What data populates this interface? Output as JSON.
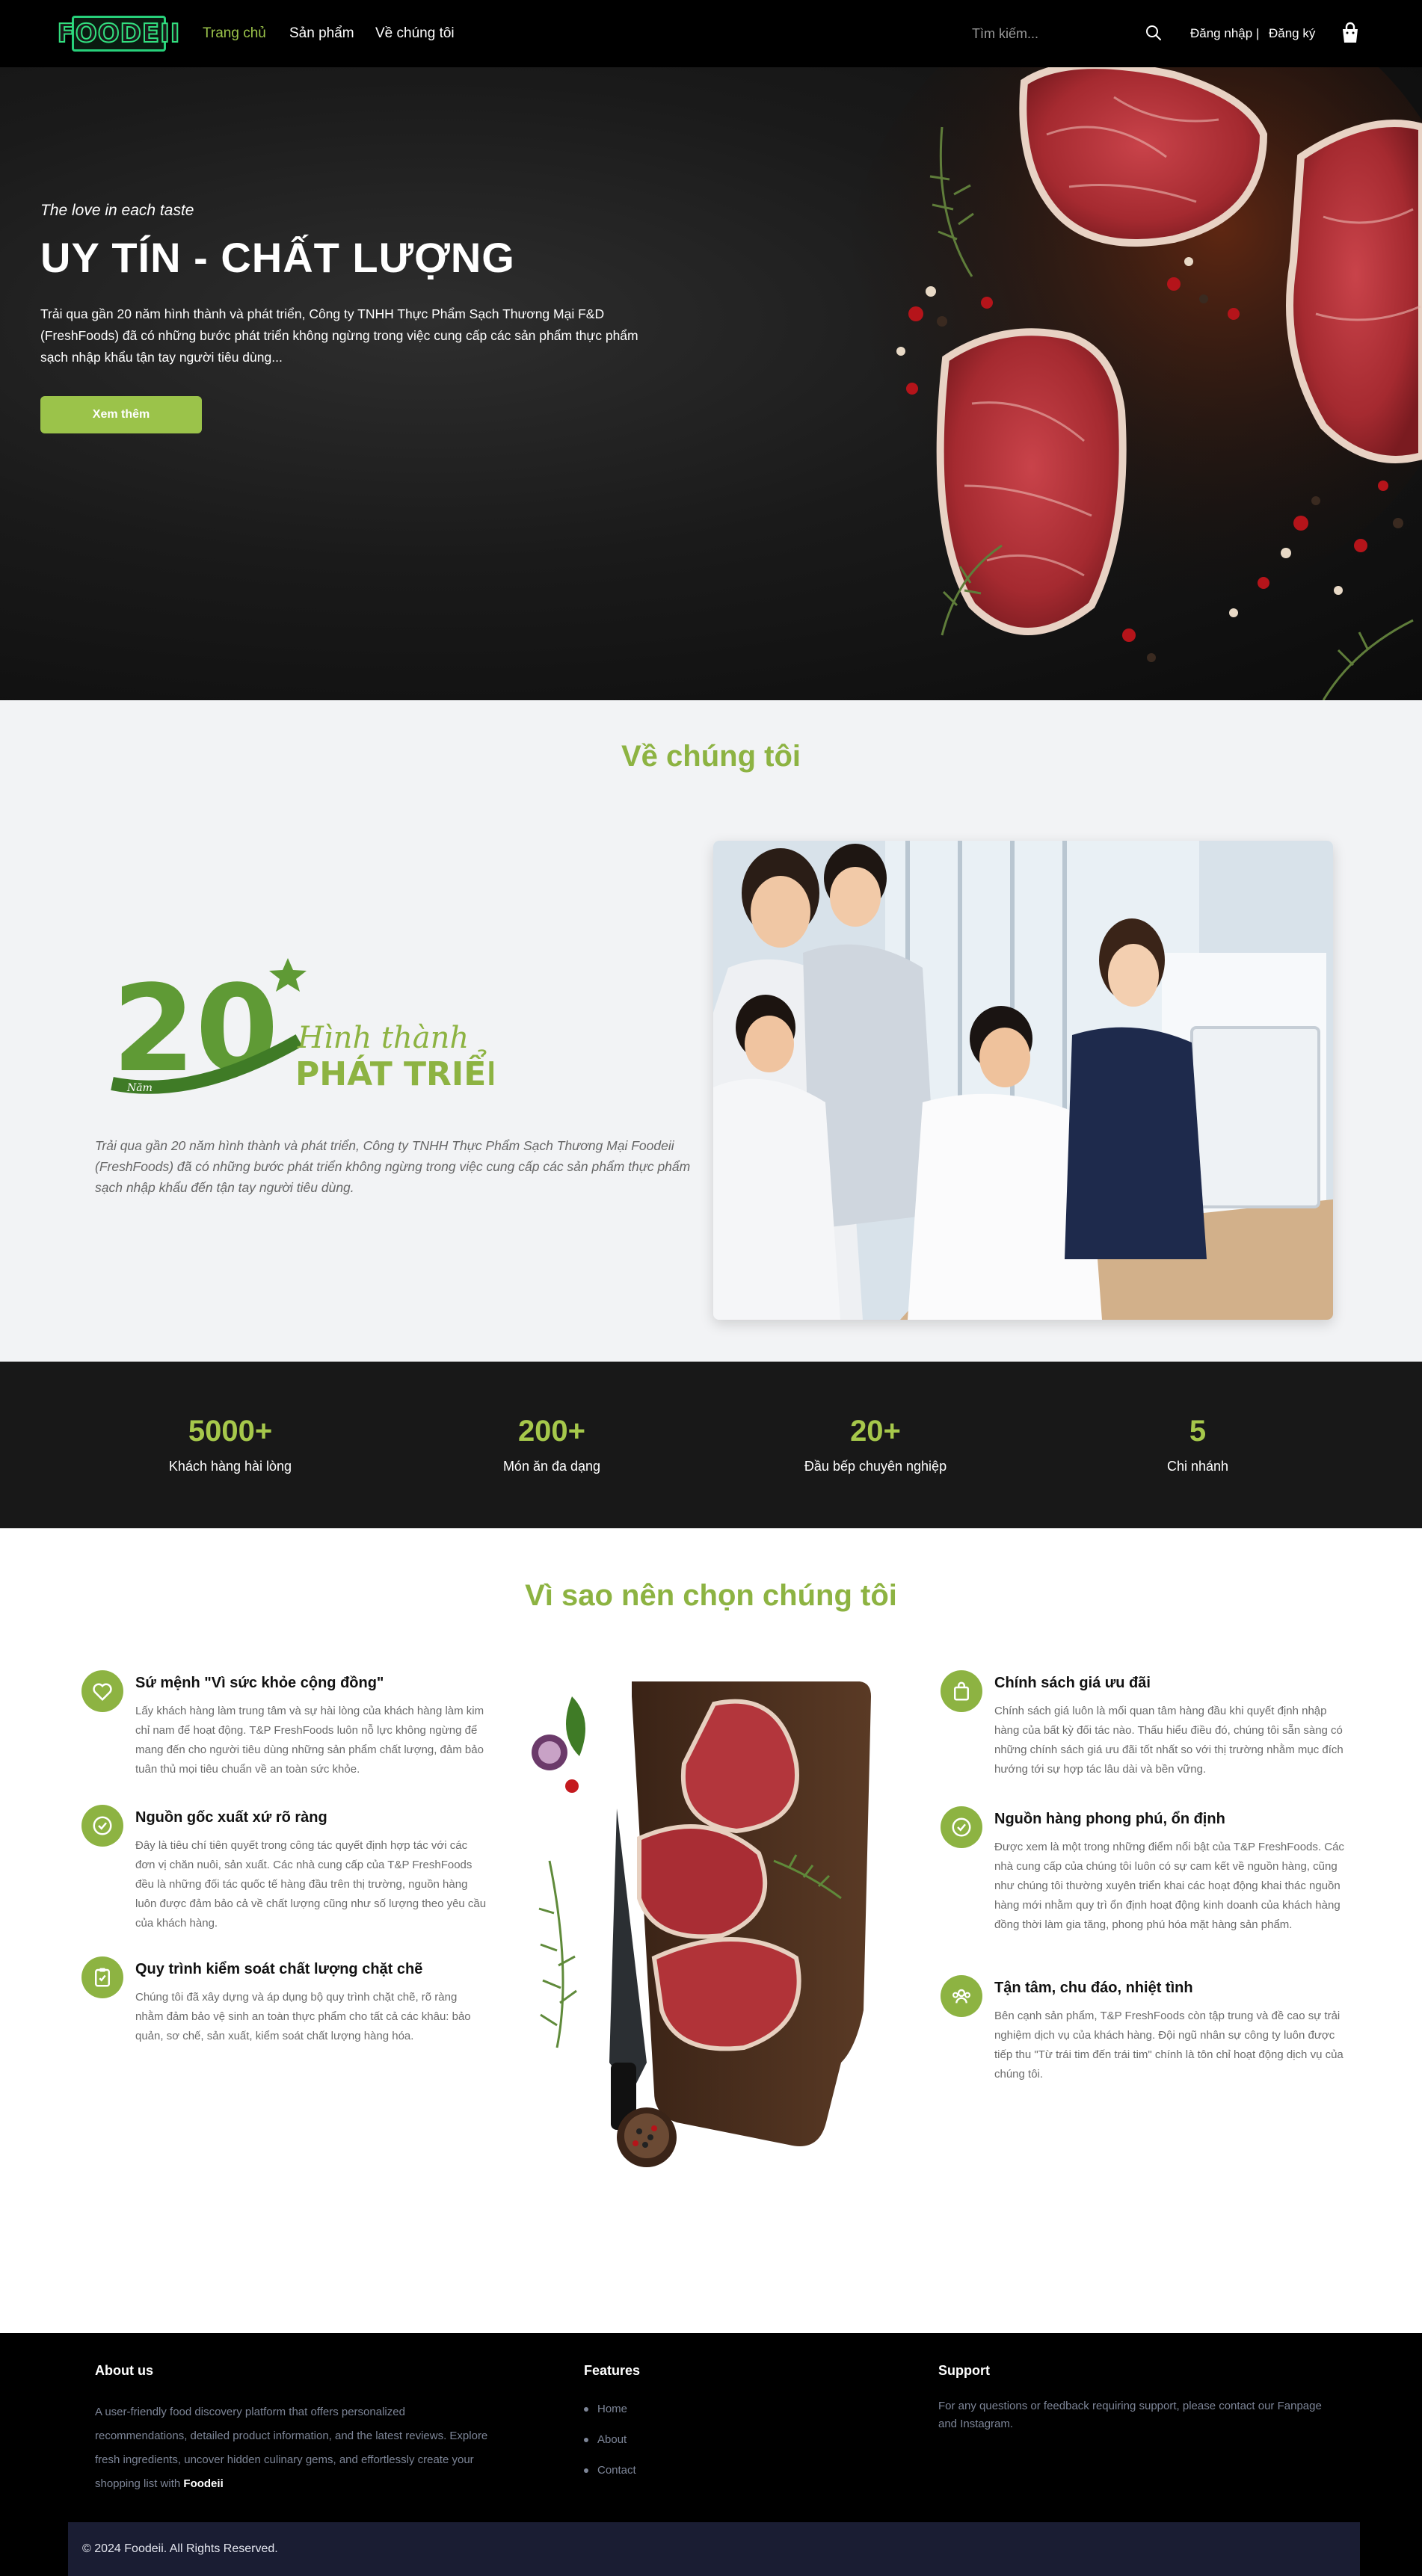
{
  "nav": {
    "logo": "FOODEII",
    "links": [
      "Trang chủ",
      "Sản phẩm",
      "Về chúng tôi"
    ],
    "active_index": 0,
    "search_placeholder": "Tìm kiếm...",
    "login": "Đăng nhập",
    "separator": "|",
    "register": "Đăng ký",
    "icons": [
      "search-icon",
      "shopping-bag-icon"
    ]
  },
  "hero": {
    "tagline": "The love in each taste",
    "title": "UY TÍN - CHẤT LƯỢNG",
    "description": "Trải qua gần 20 năm hình thành và phát triển, Công ty TNHH Thực Phẩm Sạch Thương Mại F&D (FreshFoods) đã có những bước phát triển không ngừng trong việc cung cấp các sản phẩm thực phẩm sạch nhập khẩu tận tay người tiêu dùng...",
    "button": "Xem thêm"
  },
  "about": {
    "title": "Về chúng tôi",
    "badge": {
      "number": "20",
      "word_small": "Năm",
      "line1": "Hình thành",
      "line2": "PHÁT TRIỂN"
    },
    "description": "Trải qua gần 20 năm hình thành và phát triển, Công ty TNHH Thực Phẩm Sạch Thương Mại Foodeii (FreshFoods) đã có những bước phát triển không ngừng trong việc cung cấp các sản phẩm thực phẩm sạch nhập khẩu đến tận tay người tiêu dùng."
  },
  "stats": [
    {
      "value": "5000+",
      "label": "Khách hàng hài lòng"
    },
    {
      "value": "200+",
      "label": "Món ăn đa dạng"
    },
    {
      "value": "20+",
      "label": "Đầu bếp chuyên nghiệp"
    },
    {
      "value": "5",
      "label": "Chi nhánh"
    }
  ],
  "why": {
    "title": "Vì sao nên chọn chúng tôi",
    "left": [
      {
        "icon": "heart-icon",
        "title": "Sứ mệnh \"Vì sức khỏe cộng đồng\"",
        "desc": "Lấy khách hàng làm trung tâm và sự hài lòng của khách hàng làm kim chỉ nam để hoạt động. T&P FreshFoods luôn nỗ lực không ngừng để mang đến cho người tiêu dùng những sản phẩm chất lượng, đảm bảo tuân thủ mọi tiêu chuẩn về an toàn sức khỏe."
      },
      {
        "icon": "check-circle-icon",
        "title": "Nguồn gốc xuất xứ rõ ràng",
        "desc": "Đây là tiêu chí tiên quyết trong công tác quyết định hợp tác với các đơn vị chăn nuôi, sản xuất. Các nhà cung cấp của T&P FreshFoods đều là những đối tác quốc tế hàng đầu trên thị trường, nguồn hàng luôn được đảm bảo cả về chất lượng cũng như số lượng theo yêu cầu của khách hàng."
      },
      {
        "icon": "clipboard-check-icon",
        "title": "Quy trình kiểm soát chất lượng chặt chẽ",
        "desc": "Chúng tôi đã xây dựng và áp dụng bộ quy trình chặt chẽ, rõ ràng nhằm đảm bảo vệ sinh an toàn thực phẩm cho tất cả các khâu: bảo quản, sơ chế, sản xuất, kiểm soát chất lượng hàng hóa."
      }
    ],
    "right": [
      {
        "icon": "shopping-bag-icon",
        "title": "Chính sách giá ưu đãi",
        "desc": "Chính sách giá luôn là mối quan tâm hàng đầu khi quyết định nhập hàng của bất kỳ đối tác nào. Thấu hiểu điều đó, chúng tôi sẵn sàng có những chính sách giá ưu đãi tốt nhất so với thị trường nhằm mục đích hướng tới sự hợp tác lâu dài và bền vững."
      },
      {
        "icon": "check-circle-icon",
        "title": "Nguồn hàng phong phú, ổn định",
        "desc": "Được xem là một trong những điểm nổi bật của T&P FreshFoods. Các nhà cung cấp của chúng tôi luôn có sự cam kết về nguồn hàng, cũng như chúng tôi thường xuyên triển khai các hoạt động khai thác nguồn hàng mới nhằm quy trì ổn định hoạt động kinh doanh của khách hàng đồng thời làm gia tăng, phong phú hóa mặt hàng sản phẩm."
      },
      {
        "icon": "users-icon",
        "title": "Tận tâm, chu đáo, nhiệt tình",
        "desc": "Bên cạnh sản phẩm, T&P FreshFoods còn tập trung và đề cao sự trải nghiệm dịch vụ của khách hàng. Đội ngũ nhân sự công ty luôn được tiếp thu \"Từ trái tim đến trái tim\" chính là tôn chỉ hoạt động dịch vụ của chúng tôi."
      }
    ]
  },
  "footer": {
    "about_title": "About us",
    "about_text": "A user-friendly food discovery platform that offers personalized recommendations, detailed product information, and the latest reviews. Explore fresh ingredients, uncover hidden culinary gems, and effortlessly create your shopping list with",
    "about_brand": "Foodeii",
    "features_title": "Features",
    "features": [
      "Home",
      "About",
      "Contact"
    ],
    "support_title": "Support",
    "support_text": "For any questions or feedback requiring support, please contact our Fanpage and Instagram.",
    "copyright": "© 2024 Foodeii. All Rights Reserved."
  },
  "colors": {
    "accent": "#9bc34a",
    "nav_bg": "#000000",
    "stats_bg": "#181818",
    "footer_bar": "#1a1d33"
  }
}
